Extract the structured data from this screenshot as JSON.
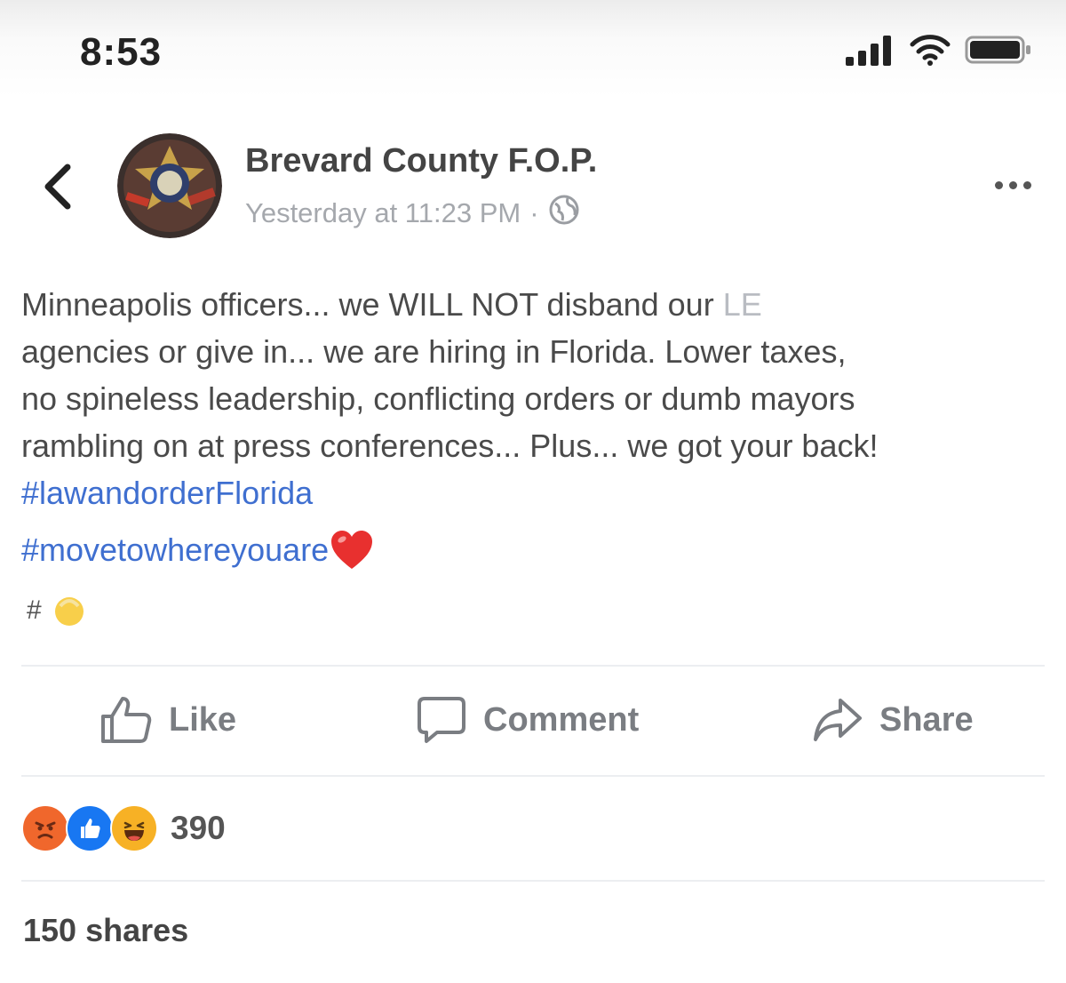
{
  "status_bar": {
    "time": "8:53",
    "icons": [
      "signal-icon",
      "wifi-icon",
      "battery-icon"
    ]
  },
  "post": {
    "page_name": "Brevard County F.O.P.",
    "timestamp": "Yesterday at 11:23 PM",
    "separator": "·",
    "audience_icon": "globe-icon",
    "text_lines": [
      "Minneapolis officers... we WILL NOT disband our ",
      "agencies or give in... we are hiring in Florida. Lower taxes,",
      "no spineless leadership, conflicting orders or dumb mayors",
      "rambling on at press conferences... Plus... we got your back!"
    ],
    "text_line1_tail": "LE",
    "hashtags": [
      "#lawandorderFlorida",
      "#movetowhereyouare"
    ],
    "heart_emoji": "❤️",
    "trailing_hash": "#",
    "trailing_emoji": "emoji-icon"
  },
  "actions": {
    "like_label": "Like",
    "comment_label": "Comment",
    "share_label": "Share"
  },
  "reactions": {
    "icons": [
      "angry-icon",
      "like-reaction-icon",
      "haha-icon"
    ],
    "count": "390"
  },
  "shares": {
    "label": "150 shares"
  },
  "colors": {
    "hashtag": "#3f6fd0",
    "like_reaction": "#1877f2",
    "angry_reaction": "#f0672c",
    "haha_reaction": "#f7b125"
  }
}
